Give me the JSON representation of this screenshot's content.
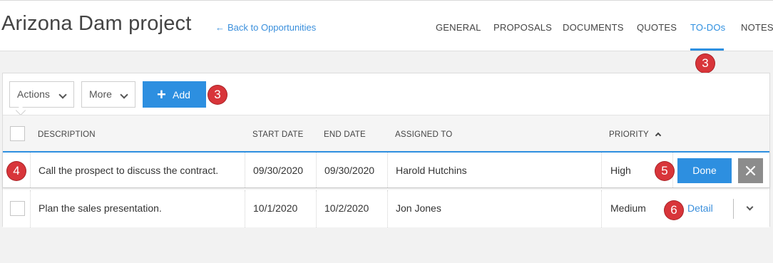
{
  "header": {
    "title": "Arizona Dam project",
    "back_link": "Back to Opportunities",
    "tabs": [
      {
        "label": "GENERAL"
      },
      {
        "label": "PROPOSALS"
      },
      {
        "label": "DOCUMENTS"
      },
      {
        "label": "QUOTES"
      },
      {
        "label": "TO-DOs"
      },
      {
        "label": "NOTES"
      }
    ],
    "active_tab": "TO-DOs"
  },
  "badges": [
    "3",
    "3",
    "4",
    "5",
    "6"
  ],
  "toolbar": {
    "actions_label": "Actions",
    "more_label": "More",
    "add_label": "Add"
  },
  "table": {
    "columns": [
      "DESCRIPTION",
      "START DATE",
      "END DATE",
      "ASSIGNED TO",
      "PRIORITY"
    ],
    "sorted_column": "PRIORITY",
    "rows": [
      {
        "description": "Call the prospect to discuss the contract.",
        "start_date": "09/30/2020",
        "end_date": "09/30/2020",
        "assigned_to": "Harold Hutchins",
        "priority": "High",
        "action": "Done"
      },
      {
        "description": "Plan the sales presentation.",
        "start_date": "10/1/2020",
        "end_date": "10/2/2020",
        "assigned_to": "Jon Jones",
        "priority": "Medium",
        "action": "Detail"
      }
    ]
  },
  "colors": {
    "accent": "#2d8fe0",
    "badge": "#d8353a",
    "close_button": "#8c8c8c"
  }
}
